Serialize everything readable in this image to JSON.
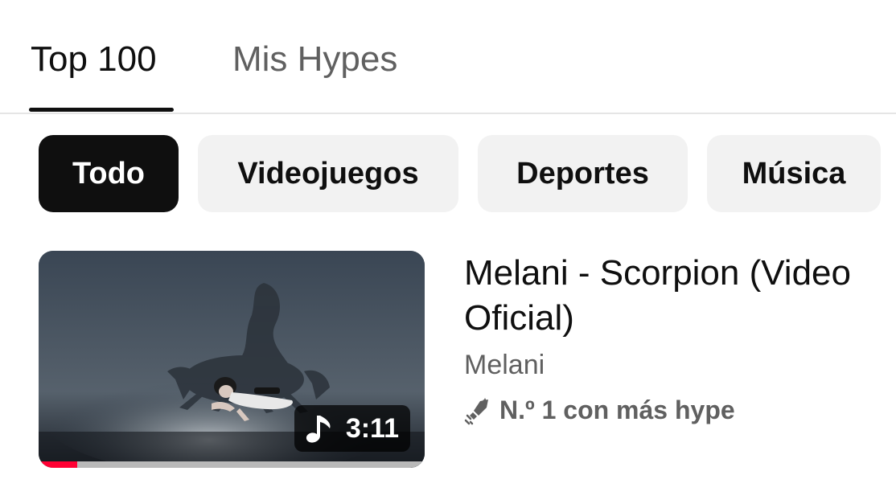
{
  "tabs": [
    {
      "label": "Top 100",
      "active": true
    },
    {
      "label": "Mis Hypes",
      "active": false
    }
  ],
  "chips": [
    {
      "label": "Todo",
      "active": true
    },
    {
      "label": "Videojuegos",
      "active": false
    },
    {
      "label": "Deportes",
      "active": false
    },
    {
      "label": "Música",
      "active": false
    }
  ],
  "video": {
    "title": "Melani - Scorpion (Video Oficial)",
    "channel": "Melani",
    "duration": "3:11",
    "hype_rank": "N.º 1 con más hype",
    "progress_fraction": 0.1,
    "duration_icon": "music-note-icon",
    "hype_icon": "hype-rocket-icon"
  },
  "colors": {
    "progress": "#ff0033",
    "active_chip": "#0f0f0f",
    "chip": "#f2f2f2"
  }
}
